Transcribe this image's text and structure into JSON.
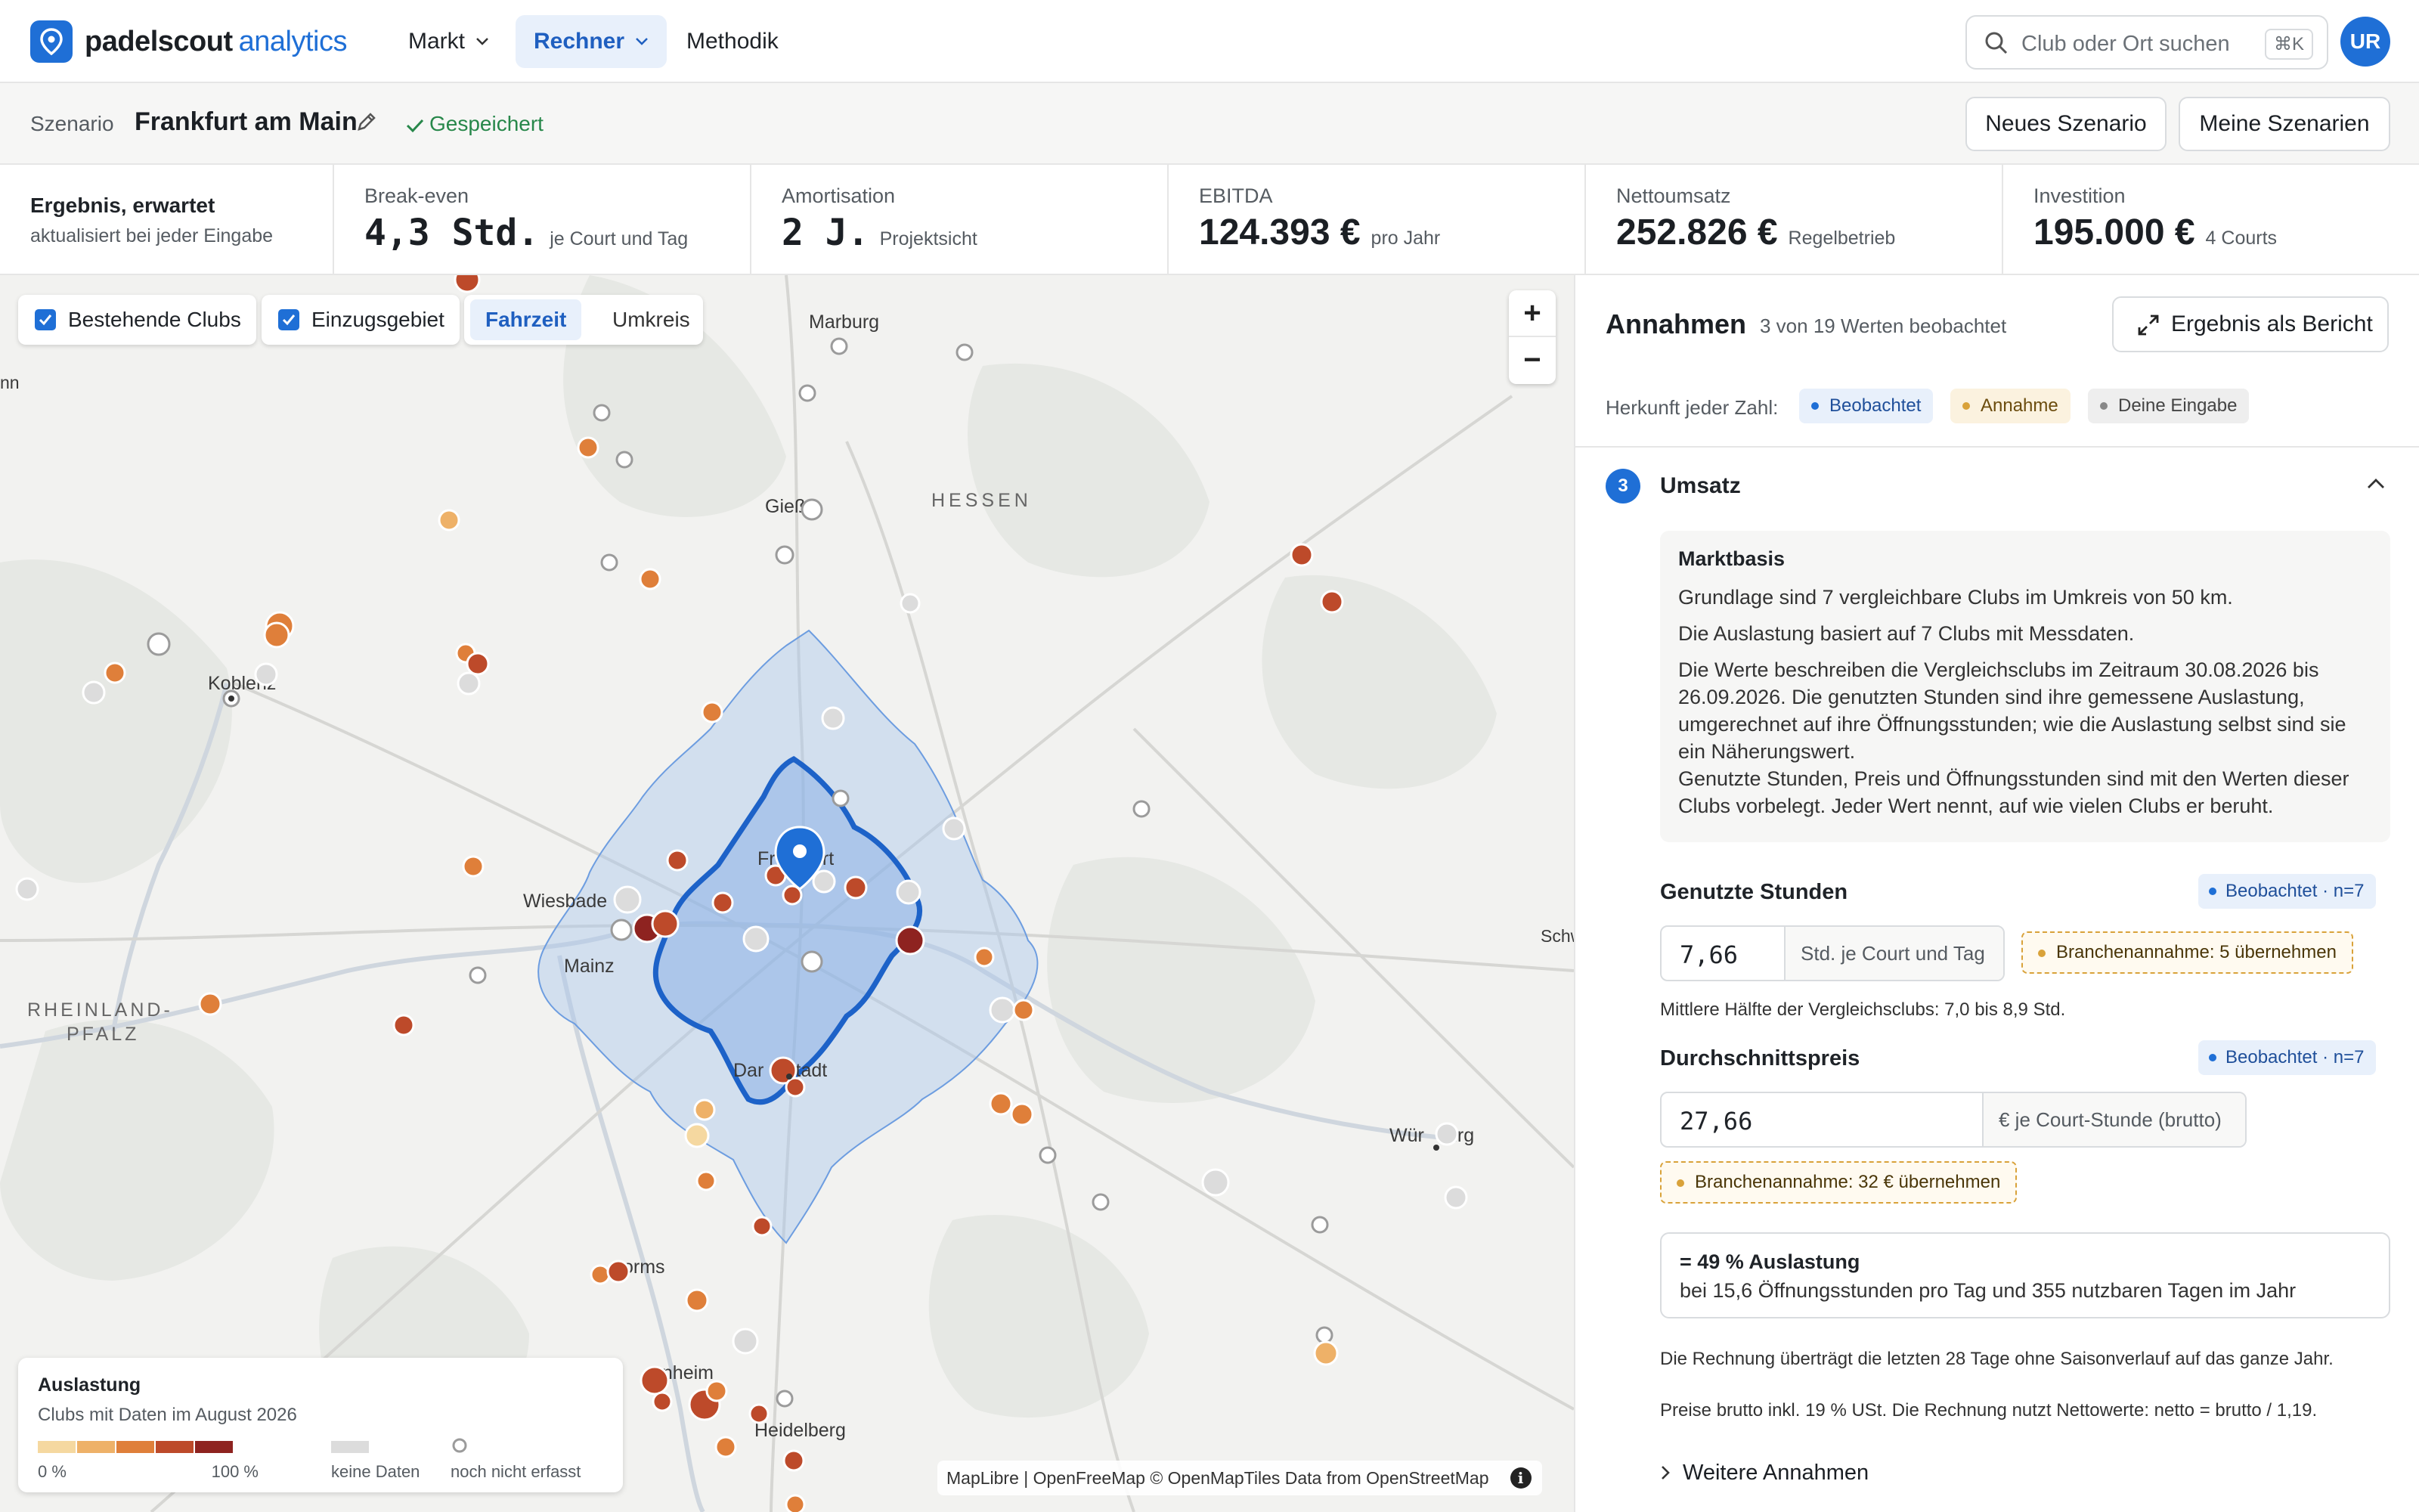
{
  "app": {
    "brand": "padelscout",
    "brand_suffix": "analytics"
  },
  "nav": [
    {
      "label": "Markt",
      "dropdown": true
    },
    {
      "label": "Rechner",
      "dropdown": true,
      "active": true
    },
    {
      "label": "Methodik",
      "dropdown": false
    }
  ],
  "search": {
    "placeholder": "Club oder Ort suchen",
    "shortcut": "⌘K"
  },
  "user": {
    "initials": "UR"
  },
  "scenario": {
    "label": "Szenario",
    "name": "Frankfurt am Main",
    "status": "Gespeichert",
    "new_button": "Neues Szenario",
    "mine_button": "Meine Szenarien"
  },
  "kpis": {
    "intro_title": "Ergebnis, erwartet",
    "intro_sub": "aktualisiert bei jeder Eingabe",
    "items": [
      {
        "label": "Break-even",
        "value": "4,3 Std.",
        "unit": "je Court und Tag"
      },
      {
        "label": "Amortisation",
        "value": "2 J.",
        "unit": "Projektsicht"
      },
      {
        "label": "EBITDA",
        "value": "124.393 €",
        "unit": "pro Jahr"
      },
      {
        "label": "Nettoumsatz",
        "value": "252.826 €",
        "unit": "Regelbetrieb"
      },
      {
        "label": "Investition",
        "value": "195.000 €",
        "unit": "4 Courts"
      }
    ]
  },
  "map": {
    "toggle_clubs": "Bestehende Clubs",
    "toggle_area": "Einzugsgebiet",
    "mode_active": "Fahrzeit",
    "mode_other": "Umkreis",
    "zoom_in": "+",
    "zoom_out": "−",
    "places": {
      "marburg": "Marburg",
      "giessen": "Gieß",
      "hessen": "HESSEN",
      "koblenz": "Koblenz",
      "frankfurt_a": "Fr",
      "frankfurt_b": "urt",
      "wiesbaden": "Wiesbade",
      "mainz": "Mainz",
      "rlp1": "RHEINLAND-",
      "rlp2": "PFALZ",
      "darmstadt_a": "Dar",
      "darmstadt_b": "stadt",
      "wuerzburg_a": "Wür",
      "wuerzburg_b": "urg",
      "worms": "orms",
      "mannheim": "nnheim",
      "heidelberg": "Heidelberg",
      "schw": "Schw",
      "nn": "nn"
    },
    "legend": {
      "title": "Auslastung",
      "subtitle": "Clubs mit Daten im August 2026",
      "min": "0 %",
      "max": "100 %",
      "no_data": "keine Daten",
      "not_recorded": "noch nicht erfasst",
      "colors": [
        "#f5d8a0",
        "#eeb168",
        "#df7f3a",
        "#bd4a2a",
        "#8e2320"
      ]
    },
    "attribution": "MapLibre | OpenFreeMap © OpenMapTiles Data from OpenStreetMap"
  },
  "panel": {
    "title": "Annahmen",
    "subtitle": "3 von 19 Werten beobachtet",
    "report_button": "Ergebnis als Bericht",
    "origin_label": "Herkunft jeder Zahl:",
    "origin": {
      "observed": "Beobachtet",
      "assumption": "Annahme",
      "input": "Deine Eingabe"
    },
    "section": {
      "number": "3",
      "title": "Umsatz",
      "market": {
        "title": "Marktbasis",
        "p1": "Grundlage sind 7 vergleichbare Clubs im Umkreis von 50 km.",
        "p2": "Die Auslastung basiert auf 7 Clubs mit Messdaten.",
        "p3": "Die Werte beschreiben die Vergleichsclubs im Zeitraum 30.08.2026 bis 26.09.2026. Die genutzten Stunden sind ihre gemessene Auslastung, umgerechnet auf ihre Öffnungsstunden; wie die Auslastung selbst sind sie ein Näherungswert.",
        "p4": "Genutzte Stunden, Preis und Öffnungsstunden sind mit den Werten dieser Clubs vorbelegt. Jeder Wert nennt, auf wie vielen Clubs er beruht."
      },
      "hours": {
        "label": "Genutzte Stunden",
        "badge": "Beobachtet · n=7",
        "value": "7,66",
        "suffix": "Std. je Court und Tag",
        "assumption": "Branchenannahme: 5  übernehmen",
        "hint": "Mittlere Hälfte der Vergleichsclubs: 7,0 bis 8,9 Std."
      },
      "price": {
        "label": "Durchschnittspreis",
        "badge": "Beobachtet · n=7",
        "value": "27,66",
        "suffix": "€ je Court-Stunde (brutto)",
        "assumption": "Branchenannahme: 32 €  übernehmen"
      },
      "result": {
        "line1": "= 49 % Auslastung",
        "line2": "bei 15,6 Öffnungsstunden pro Tag und 355 nutzbaren Tagen im Jahr"
      },
      "note1": "Die Rechnung überträgt die letzten 28 Tage ohne Saisonverlauf auf das ganze Jahr.",
      "note2": "Preise brutto inkl. 19 % USt. Die Rechnung nutzt Nettowerte: netto = brutto / 1,19.",
      "more": "Weitere Annahmen"
    }
  },
  "colors": {
    "accent": "#1f6fd6",
    "observed": "#1f6fd6",
    "assumption": "#d9a23a",
    "input": "#888888",
    "saved": "#27874a"
  }
}
